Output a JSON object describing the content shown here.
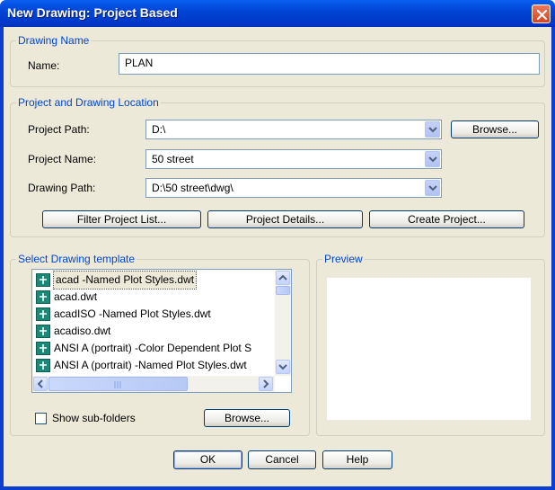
{
  "window": {
    "title": "New Drawing: Project Based"
  },
  "drawing_name": {
    "group_label": "Drawing Name",
    "name_label": "Name:",
    "name_value": "PLAN"
  },
  "location": {
    "group_label": "Project and Drawing Location",
    "project_path_label": "Project Path:",
    "project_path_value": "D:\\",
    "browse_label": "Browse...",
    "project_name_label": "Project Name:",
    "project_name_value": "50 street",
    "drawing_path_label": "Drawing Path:",
    "drawing_path_value": "D:\\50 street\\dwg\\",
    "filter_label": "Filter Project List...",
    "details_label": "Project Details...",
    "create_label": "Create Project..."
  },
  "template": {
    "group_label": "Select Drawing template",
    "items": [
      {
        "label": "acad -Named Plot Styles.dwt",
        "selected": true
      },
      {
        "label": "acad.dwt"
      },
      {
        "label": "acadISO -Named Plot Styles.dwt"
      },
      {
        "label": "acadiso.dwt"
      },
      {
        "label": "ANSI A (portrait) -Color Dependent Plot S"
      },
      {
        "label": "ANSI A (portrait) -Named Plot Styles.dwt"
      }
    ],
    "show_subfolders_label": "Show sub-folders",
    "show_subfolders_checked": false,
    "browse_label": "Browse..."
  },
  "preview": {
    "group_label": "Preview"
  },
  "footer": {
    "ok_label": "OK",
    "cancel_label": "Cancel",
    "help_label": "Help"
  },
  "icons": {
    "close": "close-icon",
    "dropdown": "chevron-down-icon",
    "template": "template-file-icon"
  }
}
